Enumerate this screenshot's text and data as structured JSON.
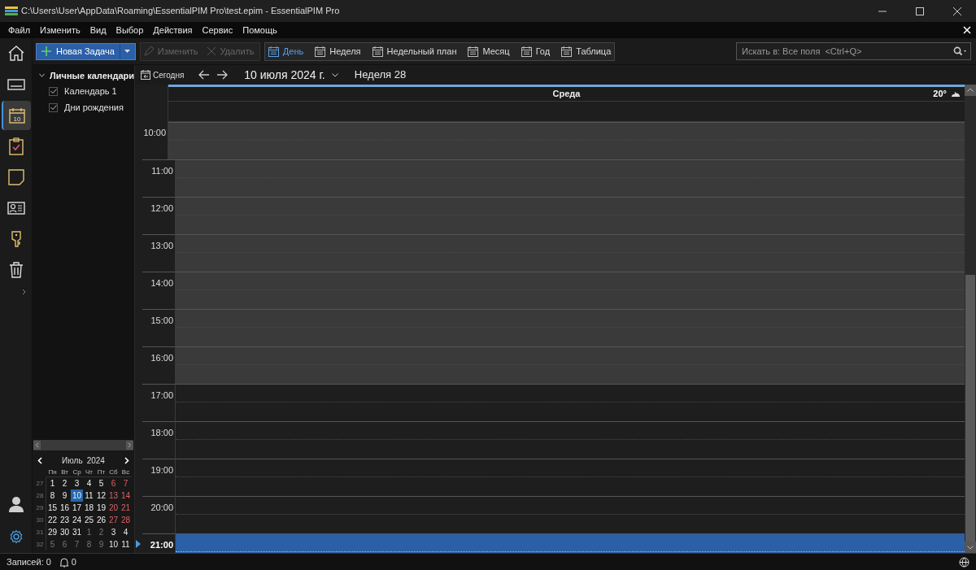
{
  "window": {
    "title": "C:\\Users\\User\\AppData\\Roaming\\EssentialPIM Pro\\test.epim - EssentialPIM Pro"
  },
  "menu": [
    "Файл",
    "Изменить",
    "Вид",
    "Выбор",
    "Действия",
    "Сервис",
    "Помощь"
  ],
  "rail": [
    {
      "kind": "home",
      "selected": false
    },
    {
      "kind": "mail",
      "selected": false
    },
    {
      "kind": "calendar",
      "selected": true,
      "label": "10"
    },
    {
      "kind": "tasks",
      "selected": false
    },
    {
      "kind": "notes",
      "selected": false
    },
    {
      "kind": "contacts",
      "selected": false
    },
    {
      "kind": "passwords",
      "selected": false
    },
    {
      "kind": "trash",
      "selected": false
    }
  ],
  "rail_bottom": [
    {
      "kind": "user"
    },
    {
      "kind": "settings"
    }
  ],
  "toolbar": {
    "new": "Новая Задача",
    "actions": [
      {
        "kind": "edit",
        "label": "Изменить",
        "disabled": true
      },
      {
        "kind": "delete",
        "label": "Удалить",
        "disabled": true
      }
    ],
    "views": [
      {
        "label": "День",
        "selected": true
      },
      {
        "label": "Неделя",
        "selected": false
      },
      {
        "label": "Недельный план",
        "selected": false
      },
      {
        "label": "Месяц",
        "selected": false
      },
      {
        "label": "Год",
        "selected": false
      },
      {
        "label": "Таблица",
        "selected": false
      }
    ]
  },
  "search": {
    "placeholder": "Искать в: Все поля  <Ctrl+Q>"
  },
  "calendars": {
    "label": "Личные календари",
    "expanded": true,
    "children": [
      {
        "label": "Календарь 1",
        "checked": true
      },
      {
        "label": "Дни рождения",
        "checked": true
      }
    ]
  },
  "mini_calendar": {
    "month": "Июль",
    "year": "2024",
    "weekdays": [
      "Пн",
      "Вт",
      "Ср",
      "Чт",
      "Пт",
      "Сб",
      "Вс"
    ],
    "weeks": [
      {
        "number": "27",
        "days": [
          {
            "d": "1",
            "other": false,
            "weekend": false,
            "selected": false
          },
          {
            "d": "2",
            "other": false,
            "weekend": false,
            "selected": false
          },
          {
            "d": "3",
            "other": false,
            "weekend": false,
            "selected": false
          },
          {
            "d": "4",
            "other": false,
            "weekend": false,
            "selected": false
          },
          {
            "d": "5",
            "other": false,
            "weekend": false,
            "selected": false
          },
          {
            "d": "6",
            "other": false,
            "weekend": true,
            "selected": false
          },
          {
            "d": "7",
            "other": false,
            "weekend": true,
            "selected": false
          }
        ]
      },
      {
        "number": "28",
        "days": [
          {
            "d": "8",
            "other": false,
            "weekend": false,
            "selected": false
          },
          {
            "d": "9",
            "other": false,
            "weekend": false,
            "selected": false
          },
          {
            "d": "10",
            "other": false,
            "weekend": false,
            "selected": true
          },
          {
            "d": "11",
            "other": false,
            "weekend": false,
            "selected": false
          },
          {
            "d": "12",
            "other": false,
            "weekend": false,
            "selected": false
          },
          {
            "d": "13",
            "other": false,
            "weekend": true,
            "selected": false
          },
          {
            "d": "14",
            "other": false,
            "weekend": true,
            "selected": false
          }
        ]
      },
      {
        "number": "29",
        "days": [
          {
            "d": "15",
            "other": false,
            "weekend": false,
            "selected": false
          },
          {
            "d": "16",
            "other": false,
            "weekend": false,
            "selected": false
          },
          {
            "d": "17",
            "other": false,
            "weekend": false,
            "selected": false
          },
          {
            "d": "18",
            "other": false,
            "weekend": false,
            "selected": false
          },
          {
            "d": "19",
            "other": false,
            "weekend": false,
            "selected": false
          },
          {
            "d": "20",
            "other": false,
            "weekend": true,
            "selected": false
          },
          {
            "d": "21",
            "other": false,
            "weekend": true,
            "selected": false
          }
        ]
      },
      {
        "number": "30",
        "days": [
          {
            "d": "22",
            "other": false,
            "weekend": false,
            "selected": false
          },
          {
            "d": "23",
            "other": false,
            "weekend": false,
            "selected": false
          },
          {
            "d": "24",
            "other": false,
            "weekend": false,
            "selected": false
          },
          {
            "d": "25",
            "other": false,
            "weekend": false,
            "selected": false
          },
          {
            "d": "26",
            "other": false,
            "weekend": false,
            "selected": false
          },
          {
            "d": "27",
            "other": false,
            "weekend": true,
            "selected": false
          },
          {
            "d": "28",
            "other": false,
            "weekend": true,
            "selected": false
          }
        ]
      },
      {
        "number": "31",
        "days": [
          {
            "d": "29",
            "other": false,
            "weekend": false,
            "selected": false
          },
          {
            "d": "30",
            "other": false,
            "weekend": false,
            "selected": false
          },
          {
            "d": "31",
            "other": false,
            "weekend": false,
            "selected": false
          },
          {
            "d": "1",
            "other": true,
            "weekend": false,
            "selected": false
          },
          {
            "d": "2",
            "other": true,
            "weekend": false,
            "selected": false
          },
          {
            "d": "3",
            "other": true,
            "weekend": true,
            "selected": false
          },
          {
            "d": "4",
            "other": true,
            "weekend": true,
            "selected": false
          }
        ]
      },
      {
        "number": "32",
        "days": [
          {
            "d": "5",
            "other": true,
            "weekend": false,
            "selected": false
          },
          {
            "d": "6",
            "other": true,
            "weekend": false,
            "selected": false
          },
          {
            "d": "7",
            "other": true,
            "weekend": false,
            "selected": false
          },
          {
            "d": "8",
            "other": true,
            "weekend": false,
            "selected": false
          },
          {
            "d": "9",
            "other": true,
            "weekend": false,
            "selected": false
          },
          {
            "d": "10",
            "other": true,
            "weekend": true,
            "selected": false
          },
          {
            "d": "11",
            "other": true,
            "weekend": true,
            "selected": false
          }
        ]
      }
    ]
  },
  "day_view": {
    "today": "Сегодня",
    "date": "10 июля 2024 г.",
    "week": "Неделя 28",
    "weekday": "Среда",
    "temperature": "20°",
    "hours": [
      {
        "time": "10:00",
        "kind": "work",
        "selected": false
      },
      {
        "time": "11:00",
        "kind": "work",
        "selected": false
      },
      {
        "time": "12:00",
        "kind": "work",
        "selected": false
      },
      {
        "time": "13:00",
        "kind": "work",
        "selected": false
      },
      {
        "time": "14:00",
        "kind": "work",
        "selected": false
      },
      {
        "time": "15:00",
        "kind": "work",
        "selected": false
      },
      {
        "time": "16:00",
        "kind": "work",
        "selected": false
      },
      {
        "time": "17:00",
        "kind": "off",
        "selected": false
      },
      {
        "time": "18:00",
        "kind": "off",
        "selected": false
      },
      {
        "time": "19:00",
        "kind": "off",
        "selected": false
      },
      {
        "time": "20:00",
        "kind": "off",
        "selected": false
      },
      {
        "time": "21:00",
        "kind": "off",
        "selected": true
      }
    ]
  },
  "status_bar": {
    "records": "Записей: 0",
    "reminders": "0"
  }
}
